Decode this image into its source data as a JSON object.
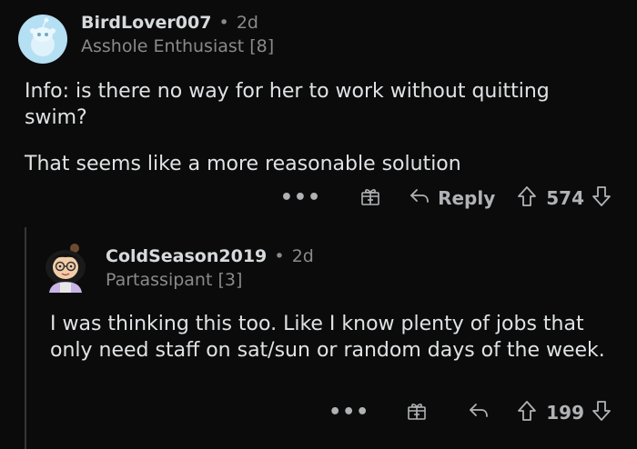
{
  "top_comment": {
    "username": "BirdLover007",
    "separator": "•",
    "time": "2d",
    "flair": "Asshole Enthusiast [8]",
    "body": [
      "Info: is there no way for her to work without quitting swim?",
      "That seems like a more reasonable solution"
    ],
    "actions": {
      "more_label": "•••",
      "reply_label": "Reply",
      "votes": "574"
    }
  },
  "reply_comment": {
    "username": "ColdSeason2019",
    "separator": "•",
    "time": "2d",
    "flair": "Partassipant [3]",
    "body": "I was thinking this too. Like I know plenty of jobs that only need staff on sat/sun or random days of the week.",
    "actions": {
      "more_label": "•••",
      "votes": "199"
    }
  },
  "icons": {
    "avatar_1": "snoo-avatar-icon",
    "avatar_2": "cartoon-avatar-icon",
    "award": "gift-icon",
    "reply": "reply-arrow-icon",
    "upvote": "upvote-arrow-icon",
    "downvote": "downvote-arrow-icon"
  },
  "colors": {
    "background": "#0b0b0b",
    "text": "#e0e3e5",
    "muted": "#8a8a8a",
    "avatar_1_bg": "#b5dff3"
  }
}
